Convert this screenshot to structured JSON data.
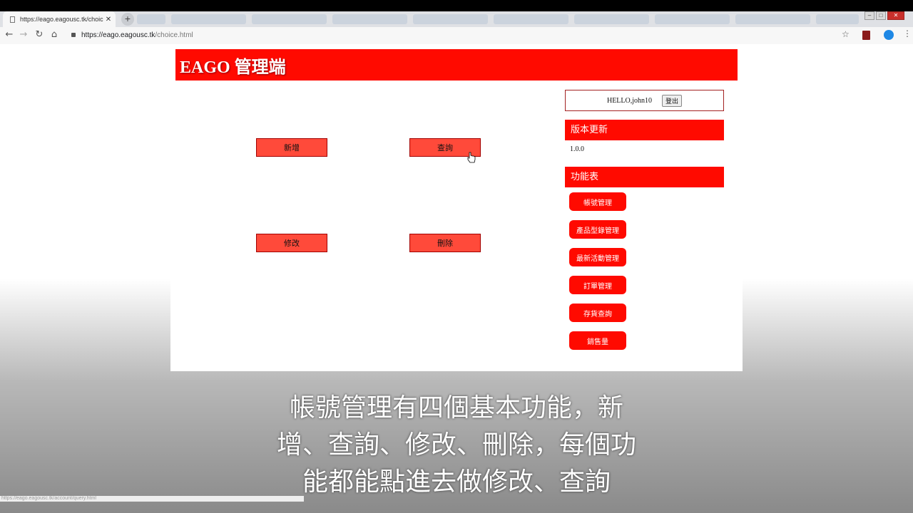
{
  "browser": {
    "tab_title": "https://eago.eagousc.tk/choic",
    "tab_close": "✕",
    "new_tab": "+",
    "url_host": "https://eago.eagousc.tk",
    "url_path": "/choice.html",
    "status_url": "https://eago.eagousc.tk/account/query.html"
  },
  "header": {
    "title": "EAGO 管理端"
  },
  "actions": {
    "add": "新增",
    "query": "查詢",
    "edit": "修改",
    "delete": "刪除"
  },
  "user": {
    "greeting": "HELLO,john10",
    "logout": "登出"
  },
  "version_section": {
    "title": "版本更新",
    "version": "1.0.0"
  },
  "menu_section": {
    "title": "功能表",
    "items": [
      "帳號管理",
      "產品型錄管理",
      "最新活動管理",
      "訂單管理",
      "存貨查詢",
      "銷售量"
    ]
  },
  "subtitle": {
    "lines": [
      "帳號管理有四個基本功能，新",
      "增、查詢、修改、刪除，每個功",
      "能都能點進去做修改、查詢"
    ]
  },
  "colors": {
    "accent": "#ff0a00",
    "button": "#ff4a3a"
  }
}
